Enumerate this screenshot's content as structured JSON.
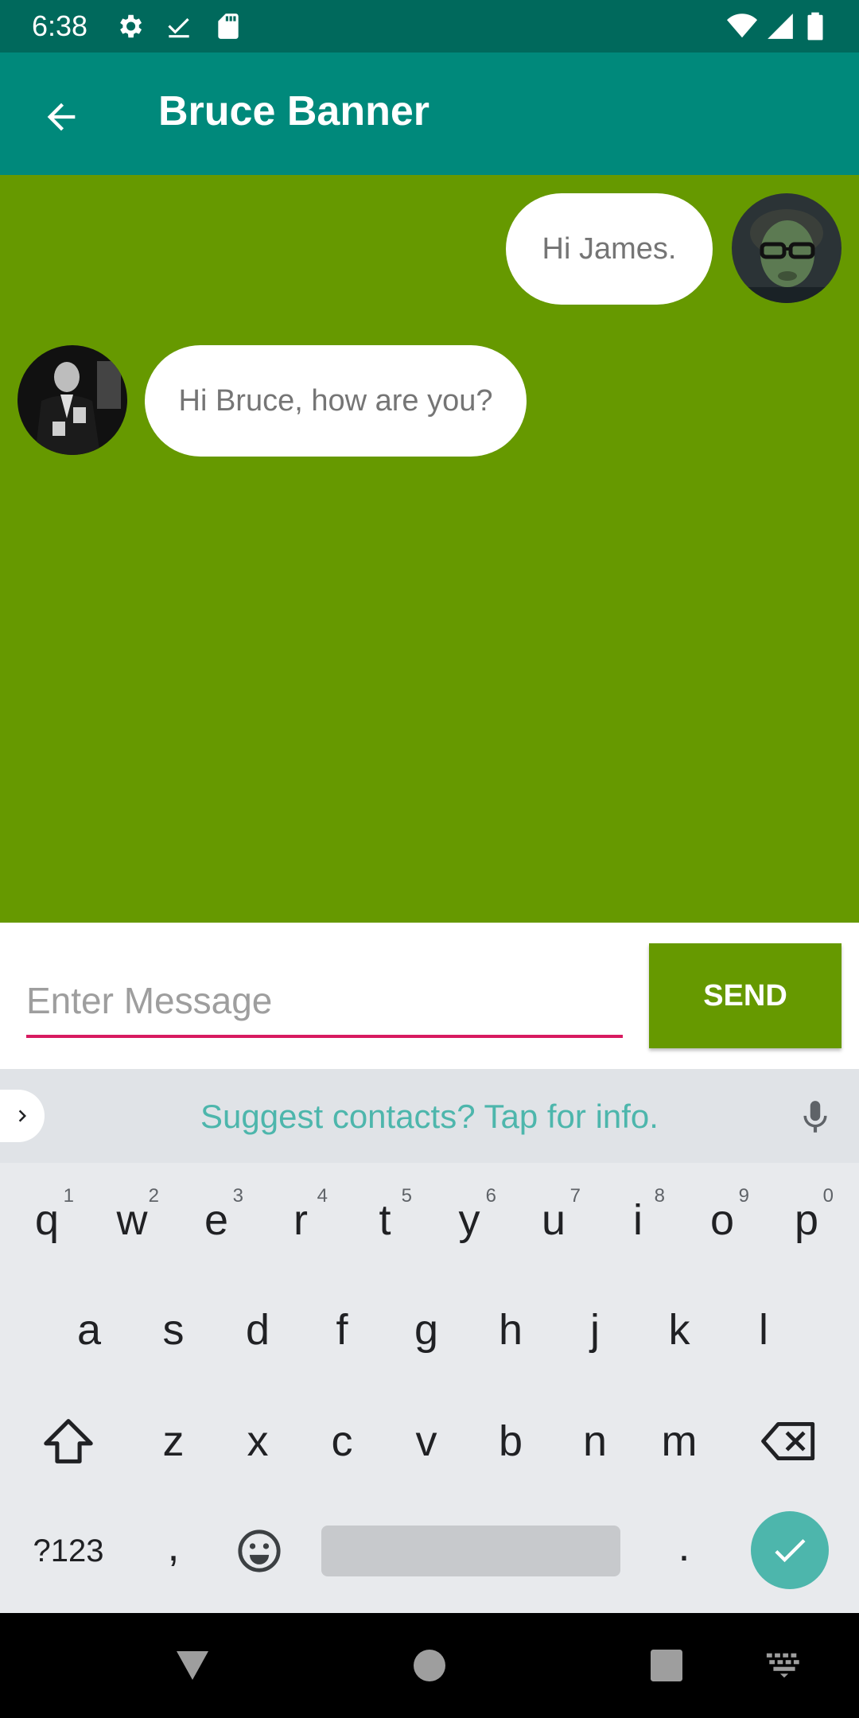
{
  "status_bar": {
    "time": "6:38",
    "left_icons": [
      "gear-icon",
      "download-done-icon",
      "sd-card-icon"
    ],
    "right_icons": [
      "wifi-icon",
      "cell-signal-icon",
      "battery-icon"
    ]
  },
  "app_bar": {
    "title": "Bruce Banner",
    "back_icon": "arrow-back-icon",
    "background": "#00897b"
  },
  "chat": {
    "background": "#669900",
    "messages": [
      {
        "side": "right",
        "text": "Hi James."
      },
      {
        "side": "left",
        "text": "Hi Bruce, how are you?"
      }
    ]
  },
  "composer": {
    "placeholder": "Enter Message",
    "value": "",
    "send_label": "SEND",
    "accent": "#d81b60"
  },
  "keyboard": {
    "suggestion": "Suggest contacts? Tap for info.",
    "row1": [
      {
        "k": "q",
        "h": "1"
      },
      {
        "k": "w",
        "h": "2"
      },
      {
        "k": "e",
        "h": "3"
      },
      {
        "k": "r",
        "h": "4"
      },
      {
        "k": "t",
        "h": "5"
      },
      {
        "k": "y",
        "h": "6"
      },
      {
        "k": "u",
        "h": "7"
      },
      {
        "k": "i",
        "h": "8"
      },
      {
        "k": "o",
        "h": "9"
      },
      {
        "k": "p",
        "h": "0"
      }
    ],
    "row2": [
      "a",
      "s",
      "d",
      "f",
      "g",
      "h",
      "j",
      "k",
      "l"
    ],
    "row3": [
      "z",
      "x",
      "c",
      "v",
      "b",
      "n",
      "m"
    ],
    "symbols_label": "?123",
    "comma": ",",
    "period": ".",
    "enter_color": "#4db6ac"
  },
  "nav_bar": {
    "icons": [
      "back-triangle-icon",
      "home-circle-icon",
      "recents-square-icon",
      "keyboard-switch-icon"
    ]
  }
}
